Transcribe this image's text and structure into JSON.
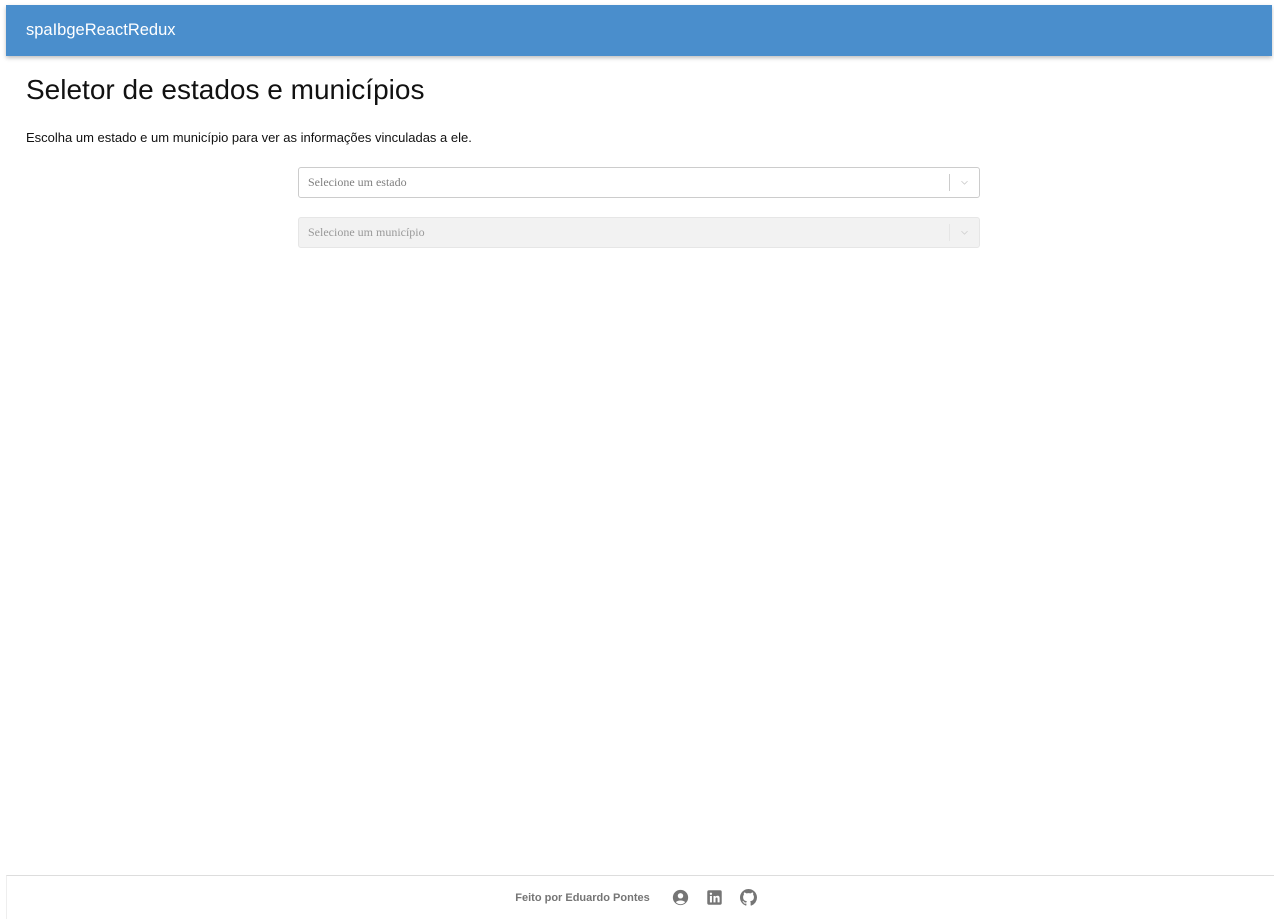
{
  "appbar": {
    "title": "spaIbgeReactRedux"
  },
  "main": {
    "title": "Seletor de estados e municípios",
    "description": "Escolha um estado e um município para ver as informações vinculadas a ele."
  },
  "selects": {
    "state": {
      "placeholder": "Selecione um estado",
      "disabled": false
    },
    "municipality": {
      "placeholder": "Selecione um município",
      "disabled": true
    }
  },
  "footer": {
    "credit": "Feito por Eduardo Pontes",
    "icons": [
      "user-circle-icon",
      "linkedin-icon",
      "github-icon"
    ]
  },
  "colors": {
    "appbar": "#4a8ecc",
    "footer_icon": "#757575"
  }
}
